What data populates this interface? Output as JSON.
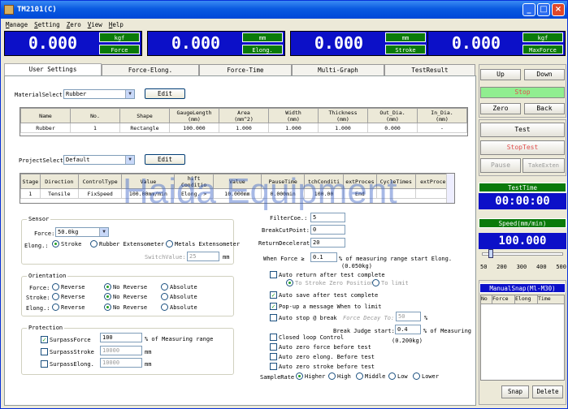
{
  "title": "TM2101(C)",
  "menu": [
    "Manage",
    "Setting",
    "Zero",
    "View",
    "Help"
  ],
  "readouts": [
    {
      "value": "0.000",
      "unit": "kgf",
      "name": "Force"
    },
    {
      "value": "0.000",
      "unit": "mm",
      "name": "Elong."
    },
    {
      "value": "0.000",
      "unit": "mm",
      "name": "Stroke"
    },
    {
      "value": "0.000",
      "unit": "kgf",
      "name": "MaxForce"
    }
  ],
  "tabs": [
    "User Settings",
    "Force-Elong.",
    "Force-Time",
    "Multi-Graph",
    "TestResult"
  ],
  "material": {
    "label": "MaterialSelect",
    "value": "Rubber",
    "edit": "Edit",
    "headers": [
      "Name",
      "No.",
      "Shape",
      "GaugeLength\n(mm)",
      "Area\n(mm^2)",
      "Width\n(mm)",
      "Thickness\n(mm)",
      "Out_Dia.\n(mm)",
      "In_Dia.\n(mm)"
    ],
    "row": [
      "Rubber",
      "1",
      "Rectangle",
      "100.000",
      "1.000",
      "1.000",
      "1.000",
      "0.000",
      "-"
    ]
  },
  "project": {
    "label": "ProjectSelect",
    "value": "Default",
    "edit": "Edit",
    "headers": [
      "Stage",
      "Direction",
      "ControlType",
      "Value",
      "hift Conditio",
      "Value",
      "PauseTime",
      "tchConditi",
      "extProces",
      "CycleTimes",
      "extProces"
    ],
    "row": [
      "1",
      "Tensile",
      "FixSpeed",
      "100.00mm/min",
      "Elong. >",
      "10.000mm",
      "0.000min",
      "100.00",
      "End",
      "",
      ""
    ]
  },
  "sensor": {
    "title": "Sensor",
    "force_label": "Force:",
    "force_value": "50.0kg",
    "elong_label": "Elong.:",
    "options": [
      "Stroke",
      "Rubber Extensometer",
      "Metals Extensometer"
    ],
    "switch_label": "SwitchValue:",
    "switch_value": "25",
    "switch_unit": "mm"
  },
  "orientation": {
    "title": "Orientation",
    "rows": [
      "Force:",
      "Stroke:",
      "Elong.:"
    ],
    "options": [
      "Reverse",
      "No Reverse",
      "Absolute"
    ]
  },
  "protection": {
    "title": "Protection",
    "items": [
      {
        "label": "SurpassForce",
        "value": "100",
        "unit": "% of Measuring range"
      },
      {
        "label": "SurpassStroke",
        "value": "10000",
        "unit": "mm"
      },
      {
        "label": "SurpassElong.",
        "value": "10000",
        "unit": "mm"
      }
    ]
  },
  "params": {
    "filter_label": "FilterCoe.:",
    "filter_value": "5",
    "breakcut_label": "BreakCutPoint:",
    "breakcut_value": "0",
    "return_label": "ReturnDecelerat",
    "return_value": "20",
    "when_force_label": "When Force ≥",
    "when_force_value": "0.1",
    "when_force_unit": "% of measuring range start Elong.",
    "when_force_note": "(0.050kg)",
    "auto_return": "Auto return after test complete",
    "to_stroke": "To Stroke Zero Position",
    "to_limit": "To limit",
    "auto_save": "Auto save after test complete",
    "popup": "Pop-up a message When to limit",
    "auto_stop": "Auto stop @ break",
    "force_decay": "Force Decay To:",
    "force_decay_value": "50",
    "pct": "%",
    "break_judge": "Break Judge start:",
    "break_judge_value": "0.4",
    "break_judge_unit": "% of Measuring",
    "break_judge_note": "(0.200kg)",
    "closed_loop": "Closed loop Control",
    "az_force": "Auto zero force before test",
    "az_elong": "Auto zero elong. Before test",
    "az_stroke": "Auto zero stroke before test",
    "sample_label": "SampleRate",
    "sample_options": [
      "Higher",
      "High",
      "Middle",
      "Low",
      "Lower"
    ]
  },
  "right": {
    "up": "Up",
    "down": "Down",
    "stop": "Stop",
    "zero": "Zero",
    "back": "Back",
    "test": "Test",
    "stoptest": "StopTest",
    "pause": "Pause",
    "takeexten": "TakeExten",
    "testtime_label": "TestTime",
    "testtime": "00:00:00",
    "speed_label": "Speed(mm/min)",
    "speed": "100.000",
    "ticks": [
      "50",
      "200",
      "300",
      "400",
      "500"
    ],
    "snap_label": "ManualSnap(Ml-M30)",
    "snap_cols": [
      "No",
      "Force",
      "Elong",
      "Time"
    ],
    "snap_btn": "Snap",
    "delete_btn": "Delete"
  },
  "watermark": "Haida Equipment"
}
